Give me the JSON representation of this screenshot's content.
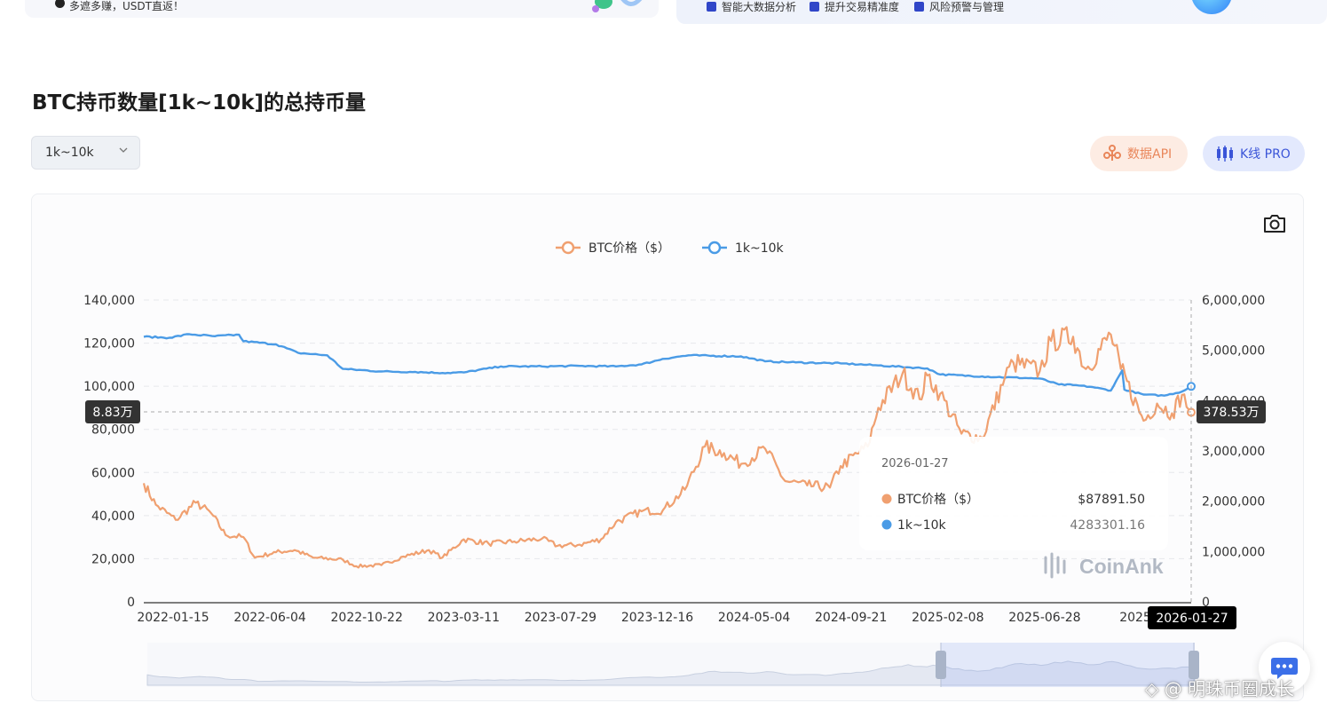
{
  "banner": {
    "left_text": "多遮多赚，USDT直返！",
    "features": [
      "智能大数据分析",
      "提升交易精准度",
      "风险预警与管理"
    ]
  },
  "page": {
    "title": "BTC持币数量[1k~10k]的总持币量"
  },
  "filter": {
    "selected": "1k~10k"
  },
  "buttons": {
    "api_label": "数据API",
    "kline_label": "K线 PRO"
  },
  "colors": {
    "price": "#f0a070",
    "holdings": "#4a9be6",
    "accent_blue": "#3b55d8",
    "accent_orange": "#e9865a"
  },
  "icons": [
    "camera-icon",
    "api-icon",
    "candlestick-icon",
    "chevron-down-icon",
    "chat-icon"
  ],
  "watermark": {
    "brand": "CoinAnk",
    "user": "◇ @ 明珠币圈成长"
  },
  "chart_data": {
    "type": "line",
    "title": "",
    "legend_position": "top-center",
    "grid": true,
    "series": [
      {
        "name": "BTC价格（$）",
        "axis": "left",
        "points": [
          [
            "2022-01-15",
            55000
          ],
          [
            "2022-02-01",
            45000
          ],
          [
            "2022-03-01",
            38000
          ],
          [
            "2022-03-29",
            46000
          ],
          [
            "2022-04-20",
            41000
          ],
          [
            "2022-05-10",
            31000
          ],
          [
            "2022-06-04",
            30000
          ],
          [
            "2022-06-20",
            20500
          ],
          [
            "2022-07-20",
            23000
          ],
          [
            "2022-08-15",
            24000
          ],
          [
            "2022-09-10",
            20500
          ],
          [
            "2022-10-22",
            19500
          ],
          [
            "2022-11-10",
            16500
          ],
          [
            "2022-12-15",
            17000
          ],
          [
            "2023-01-15",
            21000
          ],
          [
            "2023-02-20",
            24000
          ],
          [
            "2023-03-11",
            20500
          ],
          [
            "2023-04-10",
            29000
          ],
          [
            "2023-05-15",
            27000
          ],
          [
            "2023-06-20",
            28000
          ],
          [
            "2023-07-29",
            29300
          ],
          [
            "2023-08-20",
            26000
          ],
          [
            "2023-09-20",
            26500
          ],
          [
            "2023-10-20",
            29000
          ],
          [
            "2023-11-10",
            37000
          ],
          [
            "2023-12-16",
            42000
          ],
          [
            "2024-01-15",
            42500
          ],
          [
            "2024-02-15",
            52000
          ],
          [
            "2024-03-14",
            72000
          ],
          [
            "2024-04-10",
            69000
          ],
          [
            "2024-05-04",
            64000
          ],
          [
            "2024-06-07",
            71000
          ],
          [
            "2024-07-05",
            56000
          ],
          [
            "2024-08-05",
            54000
          ],
          [
            "2024-09-06",
            53000
          ],
          [
            "2024-09-21",
            63000
          ],
          [
            "2024-10-29",
            72000
          ],
          [
            "2024-11-13",
            90000
          ],
          [
            "2024-12-17",
            106000
          ],
          [
            "2025-01-10",
            94000
          ],
          [
            "2025-01-21",
            105000
          ],
          [
            "2025-02-08",
            96500
          ],
          [
            "2025-03-10",
            78000
          ],
          [
            "2025-04-08",
            76000
          ],
          [
            "2025-05-10",
            104000
          ],
          [
            "2025-05-22",
            111000
          ],
          [
            "2025-06-28",
            107000
          ],
          [
            "2025-07-14",
            121000
          ],
          [
            "2025-08-14",
            123000
          ],
          [
            "2025-09-01",
            108000
          ],
          [
            "2025-10-06",
            124000
          ],
          [
            "2025-10-20",
            108000
          ],
          [
            "2025-11-21",
            84000
          ],
          [
            "2025-12-10",
            92000
          ],
          [
            "2025-12-31",
            87500
          ],
          [
            "2026-01-14",
            96000
          ],
          [
            "2026-01-27",
            87891.5
          ]
        ]
      },
      {
        "name": "1k~10k",
        "axis": "right",
        "points": [
          [
            "2022-01-15",
            5270000
          ],
          [
            "2022-02-20",
            5250000
          ],
          [
            "2022-03-20",
            5320000
          ],
          [
            "2022-04-25",
            5280000
          ],
          [
            "2022-05-29",
            5310000
          ],
          [
            "2022-06-04",
            5180000
          ],
          [
            "2022-07-20",
            5120000
          ],
          [
            "2022-08-20",
            4950000
          ],
          [
            "2022-09-30",
            4900000
          ],
          [
            "2022-10-22",
            4630000
          ],
          [
            "2022-12-15",
            4580000
          ],
          [
            "2023-02-01",
            4570000
          ],
          [
            "2023-03-11",
            4550000
          ],
          [
            "2023-04-10",
            4560000
          ],
          [
            "2023-06-01",
            4680000
          ],
          [
            "2023-07-29",
            4680000
          ],
          [
            "2023-09-20",
            4690000
          ],
          [
            "2023-11-10",
            4680000
          ],
          [
            "2023-12-16",
            4720000
          ],
          [
            "2024-01-15",
            4830000
          ],
          [
            "2024-02-20",
            4900000
          ],
          [
            "2024-05-04",
            4880000
          ],
          [
            "2024-06-07",
            4780000
          ],
          [
            "2024-07-20",
            4760000
          ],
          [
            "2024-09-21",
            4740000
          ],
          [
            "2024-11-13",
            4700000
          ],
          [
            "2025-01-21",
            4640000
          ],
          [
            "2025-02-08",
            4520000
          ],
          [
            "2025-04-08",
            4480000
          ],
          [
            "2025-06-28",
            4440000
          ],
          [
            "2025-07-25",
            4320000
          ],
          [
            "2025-08-14",
            4310000
          ],
          [
            "2025-09-10",
            4270000
          ],
          [
            "2025-10-06",
            4200000
          ],
          [
            "2025-10-22",
            4600000
          ],
          [
            "2025-10-25",
            4220000
          ],
          [
            "2025-11-21",
            4120000
          ],
          [
            "2025-12-20",
            4100000
          ],
          [
            "2026-01-14",
            4180000
          ],
          [
            "2026-01-27",
            4283301.16
          ]
        ]
      }
    ],
    "x_ticks": [
      "2022-01-15",
      "2022-06-04",
      "2022-10-22",
      "2023-03-11",
      "2023-07-29",
      "2023-12-16",
      "2024-05-04",
      "2024-09-21",
      "2025-02-08",
      "2025-06-28",
      "2025-1",
      "2026-01-27"
    ],
    "xlim": [
      "2022-01-15",
      "2026-01-27"
    ],
    "y_left": {
      "ticks": [
        "0",
        "20,000",
        "40,000",
        "60,000",
        "80,000",
        "100,000",
        "120,000",
        "140,000"
      ],
      "ylim": [
        0,
        140000
      ]
    },
    "y_right": {
      "ticks": [
        "0",
        "1,000,000",
        "2,000,000",
        "3,000,000",
        "4,000,000",
        "5,000,000",
        "6,000,000"
      ],
      "ylim": [
        0,
        6000000
      ]
    },
    "crosshair": {
      "date": "2026-01-27",
      "left_label": "8.83万",
      "right_label": "378.53万"
    },
    "tooltip": {
      "date": "2026-01-27",
      "rows": [
        {
          "name": "BTC价格（$）",
          "value": "$87891.50"
        },
        {
          "name": "1k~10k",
          "value": "4283301.16"
        }
      ]
    }
  }
}
